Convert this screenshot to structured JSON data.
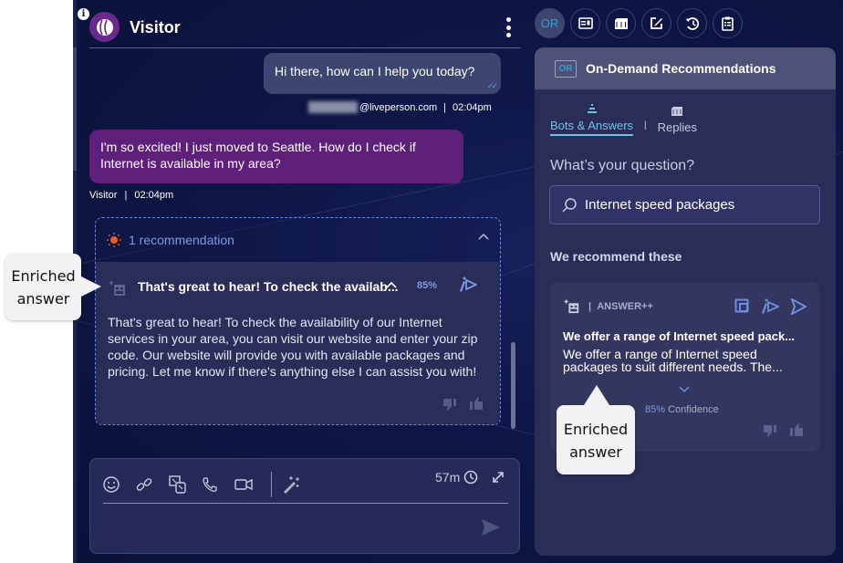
{
  "chat": {
    "header": {
      "name": "Visitor"
    },
    "messages": [
      {
        "from": "agent",
        "text": "Hi there, how can I help you today?",
        "sender": "@liveperson.com",
        "separator": "|",
        "time": "02:04pm"
      },
      {
        "from": "visitor",
        "text": "I'm so excited! I just moved to Seattle. How do I check if Internet is available in my area?",
        "sender": "Visitor",
        "separator": "|",
        "time": "02:04pm"
      }
    ],
    "recommendation": {
      "count_label": "1 recommendation",
      "title": "That's great to hear! To check the availab...",
      "confidence": "85%",
      "body": "That's great to hear! To check the availability of our Internet services in your area, you can visit our website and enter your zip code. Our website will provide you with available packages and pricing. Let me know if there's anything else I can assist you with!"
    },
    "composer": {
      "timer": "57m",
      "input_value": "",
      "tools": [
        "emoji-icon",
        "link-icon",
        "translate-icon",
        "phone-icon",
        "video-icon",
        "magic-wand-icon"
      ]
    }
  },
  "widgets": {
    "active_label": "OR",
    "buttons": [
      "on-demand-recommendations",
      "visitor-info",
      "knowledge-base",
      "notes",
      "history",
      "clipboard"
    ]
  },
  "panel": {
    "badge": "OR",
    "title": "On-Demand Recommendations",
    "tabs": [
      {
        "label": "Bots & Answers",
        "active": true
      },
      {
        "label": "Replies",
        "active": false
      }
    ],
    "tab_separator": "|",
    "question_label": "What’s your question?",
    "search_value": "Internet speed packages",
    "recommend_heading": "We recommend these",
    "answer": {
      "separator": "|",
      "type": "ANSWER++",
      "title": "We offer a range of Internet speed pack...",
      "body": "We offer a range of Internet speed packages to suit different needs. The...",
      "confidence_pct": "85%",
      "confidence_label": "Confidence"
    }
  },
  "callouts": {
    "left": "Enriched answer",
    "right": "Enriched answer"
  },
  "colors": {
    "accent": "#6ec2e8",
    "visitor_bubble": "#5e2078",
    "agent_bubble": "#3c4670",
    "recommendation_icon": "#f05a1e"
  }
}
